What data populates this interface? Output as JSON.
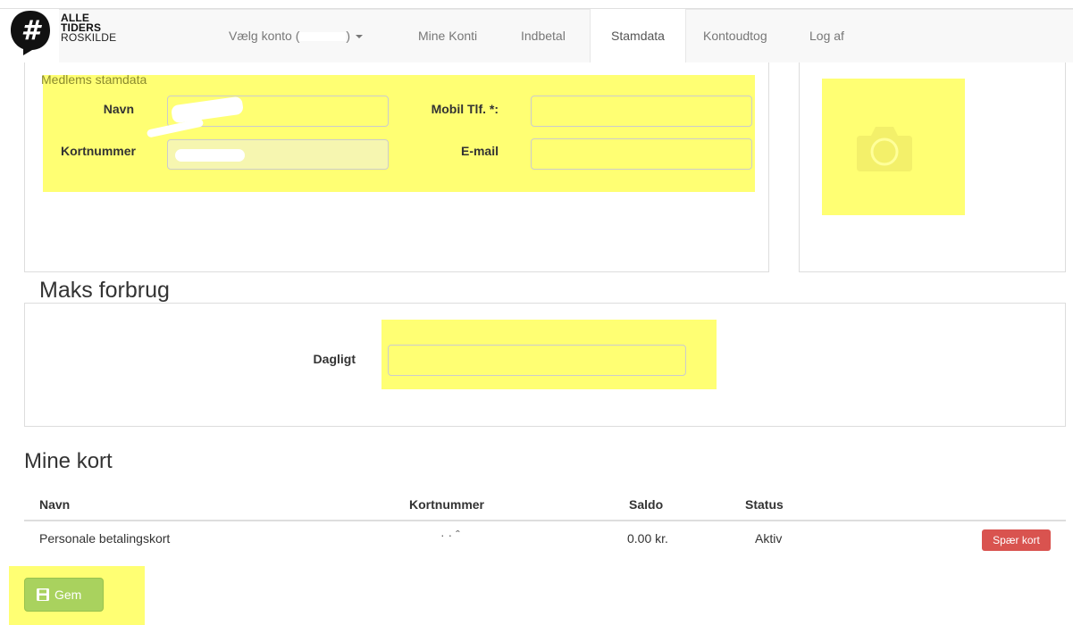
{
  "brand": {
    "line1": "ALLE",
    "line2": "TIDERS",
    "line3": "ROSKILDE",
    "symbol": "#"
  },
  "nav": {
    "account_label": "Vælg konto (",
    "account_suffix": ")",
    "items": [
      {
        "label": "Mine Konti"
      },
      {
        "label": "Indbetal"
      },
      {
        "label": "Stamdata"
      },
      {
        "label": "Kontoudtog"
      },
      {
        "label": "Log af"
      }
    ]
  },
  "member": {
    "section_title": "Medlems stamdata",
    "name_label": "Navn",
    "card_label": "Kortnummer",
    "mobile_label": "Mobil Tlf. *:",
    "email_label": "E-mail",
    "mobile_value": "",
    "email_value": ""
  },
  "limits": {
    "title": "Maks forbrug",
    "daily_label": "Dagligt",
    "daily_value": ""
  },
  "cards": {
    "title": "Mine kort",
    "headers": [
      "Navn",
      "Kortnummer",
      "Saldo",
      "Status"
    ],
    "rows": [
      {
        "name": "Personale betalingskort",
        "number": "·  ·  ˆ",
        "balance": "0.00 kr.",
        "status": "Aktiv",
        "action": "Spær kort"
      }
    ]
  },
  "save_label": "Gem",
  "colors": {
    "highlight": "#ffff00",
    "danger": "#d9534f",
    "success": "#5cb85c"
  }
}
